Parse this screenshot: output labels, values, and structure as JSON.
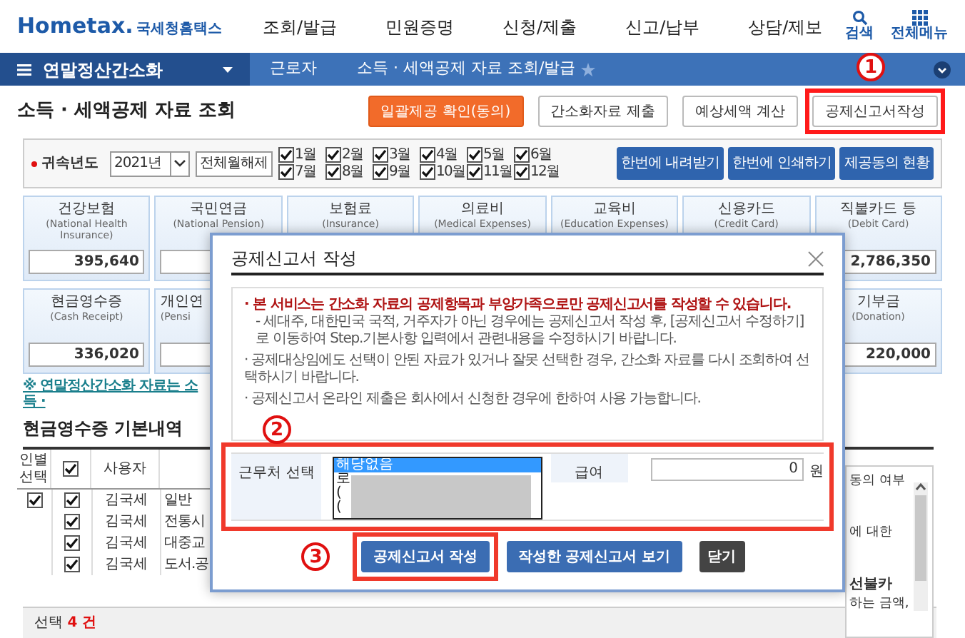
{
  "header": {
    "logo": {
      "brand": "Hometax.",
      "name": "국세청홈택스"
    },
    "nav": [
      "조회/발급",
      "민원증명",
      "신청/제출",
      "신고/납부",
      "상담/제보"
    ],
    "tools": [
      {
        "label": "검색",
        "kind": "search"
      },
      {
        "label": "전체메뉴",
        "kind": "menu"
      }
    ]
  },
  "breadcrumb": {
    "menu": "연말정산간소화",
    "items": [
      "근로자",
      "소득 · 세액공제 자료 조회/발급"
    ]
  },
  "page": {
    "title": "소득 · 세액공제 자료 조회",
    "annotation": "1",
    "buttons": [
      {
        "label": "일괄제공 확인(동의)",
        "kind": "orange"
      },
      {
        "label": "간소화자료 제출",
        "kind": "plain"
      },
      {
        "label": "예상세액 계산",
        "kind": "plain"
      },
      {
        "label": "공제신고서작성",
        "kind": "plain",
        "highlighted": true
      }
    ]
  },
  "filter": {
    "label": "귀속년도",
    "year": "2021년",
    "clear_button": "전체월해제",
    "months": [
      {
        "label": "1월",
        "checked": true
      },
      {
        "label": "7월",
        "checked": true
      },
      {
        "label": "2월",
        "checked": true
      },
      {
        "label": "8월",
        "checked": true
      },
      {
        "label": "3월",
        "checked": true
      },
      {
        "label": "9월",
        "checked": true
      },
      {
        "label": "4월",
        "checked": true
      },
      {
        "label": "10월",
        "checked": true
      },
      {
        "label": "5월",
        "checked": true
      },
      {
        "label": "11월",
        "checked": true
      },
      {
        "label": "6월",
        "checked": true
      },
      {
        "label": "12월",
        "checked": true
      }
    ],
    "buttons": [
      "한번에 내려받기",
      "한번에 인쇄하기",
      "제공동의 현황"
    ]
  },
  "cards_row_1": [
    {
      "label": "건강보험",
      "sublabel": "(National Health Insurance)",
      "value": "395,640"
    },
    {
      "label": "국민연금",
      "sublabel": "(National Pension)"
    },
    {
      "label": "보험료",
      "sublabel": "(Insurance)"
    },
    {
      "label": "의료비",
      "sublabel": "(Medical Expenses)"
    },
    {
      "label": "교육비",
      "sublabel": "(Education Expenses)"
    },
    {
      "label": "신용카드",
      "sublabel": "(Credit Card)"
    },
    {
      "label": "직불카드 등",
      "sublabel": "(Debit Card)",
      "value": "2,786,350"
    }
  ],
  "cards_row_2": [
    {
      "label": "현금영수증",
      "sublabel": "(Cash Receipt)",
      "value": "336,020"
    },
    {
      "label": "개인연",
      "sublabel": "(Pensi"
    },
    {
      "label": "기부금",
      "sublabel": "(Donation)",
      "value": "220,000"
    }
  ],
  "notice_link": "※ 연말정산간소화 자료는 소득 ·",
  "section_title": "현금영수증 기본내역",
  "table": {
    "columns": [
      {
        "label": "인별 선택",
        "kind": "text"
      },
      {
        "kind": "checkbox",
        "checked": true
      },
      {
        "label": "사용자",
        "kind": "text"
      }
    ],
    "rows": [
      {
        "person_select": true,
        "checked": true,
        "user": "김국세",
        "item": "일반"
      },
      {
        "checked": true,
        "user": "김국세",
        "item": "전통시"
      },
      {
        "checked": true,
        "user": "김국세",
        "item": "대중교"
      },
      {
        "checked": true,
        "user": "김국세",
        "item": "도서.공"
      }
    ]
  },
  "selection": {
    "label": "선택",
    "count": "4",
    "unit": "건"
  },
  "side_notes": [
    {
      "text": "동의 여부",
      "kind": "text"
    },
    {
      "text": "에 대한",
      "kind": "text"
    },
    {
      "text": "선불카",
      "kind": "heading"
    },
    {
      "text": "하는 금액,",
      "kind": "text"
    }
  ],
  "dialog": {
    "title": "공제신고서 작성",
    "notices": [
      {
        "text": "· 본 서비스는 간소화 자료의 공제항목과 부양가족으로만 공제신고서를 작성할 수 있습니다.",
        "kind": "warning"
      },
      {
        "text": "- 세대주, 대한민국 국적, 거주자가 아닌 경우에는 공제신고서 작성 후, [공제신고서 수정하기]로 이동하여 Step.기본사항 입력에서 관련내용을 수정하시기 바랍니다.",
        "kind": "sub"
      },
      {
        "text": "· 공제대상임에도 선택이 안된 자료가 있거나 잘못 선택한 경우, 간소화 자료를 다시 조회하여 선택하시기 바랍니다.",
        "kind": "bullet"
      },
      {
        "text": "· 공제신고서 온라인 제출은 회사에서 신청한 경우에 한하여 사용 가능합니다.",
        "kind": "bullet"
      }
    ],
    "form": {
      "annotation": "2",
      "highlighted": true,
      "label": "근무처 선택",
      "options": [
        {
          "text": "해당없음",
          "selected": true
        },
        {
          "text": "로",
          "selected": false
        },
        {
          "text": "(",
          "selected": false
        },
        {
          "text": "(",
          "selected": false
        }
      ],
      "amount_label": "급여",
      "amount_value": "0",
      "unit": "원"
    },
    "annotation": "3",
    "buttons": [
      {
        "label": "공제신고서 작성",
        "kind": "primary",
        "highlighted": true
      },
      {
        "label": "작성한 공제신고서 보기",
        "kind": "primary"
      },
      {
        "label": "닫기",
        "kind": "dark"
      }
    ]
  }
}
